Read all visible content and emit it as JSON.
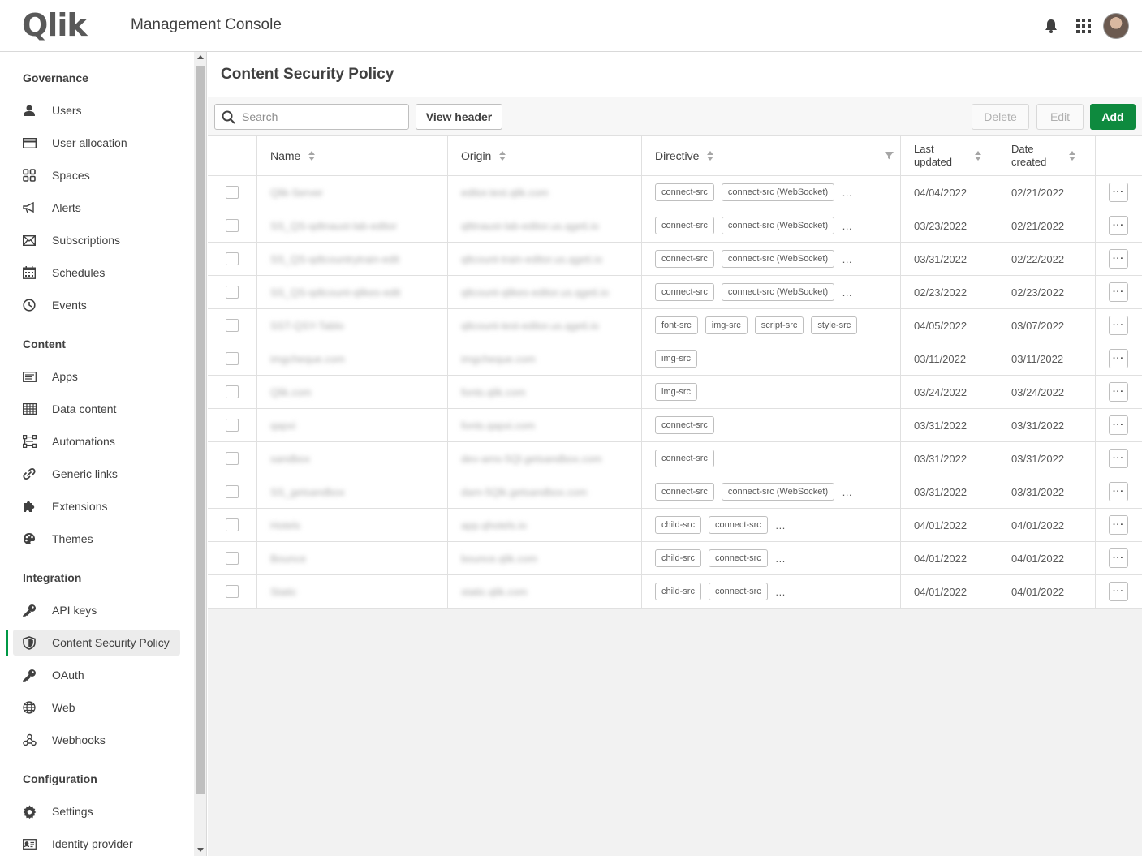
{
  "header": {
    "logo_text": "Qlik",
    "app_title": "Management Console"
  },
  "sidebar": {
    "sections": [
      {
        "title": "Governance",
        "items": [
          {
            "label": "Users",
            "icon": "user-icon"
          },
          {
            "label": "User allocation",
            "icon": "card-icon"
          },
          {
            "label": "Spaces",
            "icon": "spaces-icon"
          },
          {
            "label": "Alerts",
            "icon": "megaphone-icon"
          },
          {
            "label": "Subscriptions",
            "icon": "envelope-icon"
          },
          {
            "label": "Schedules",
            "icon": "calendar-icon"
          },
          {
            "label": "Events",
            "icon": "clock-icon"
          }
        ]
      },
      {
        "title": "Content",
        "items": [
          {
            "label": "Apps",
            "icon": "app-icon"
          },
          {
            "label": "Data content",
            "icon": "table-icon"
          },
          {
            "label": "Automations",
            "icon": "automation-icon"
          },
          {
            "label": "Generic links",
            "icon": "link-icon"
          },
          {
            "label": "Extensions",
            "icon": "puzzle-icon"
          },
          {
            "label": "Themes",
            "icon": "palette-icon"
          }
        ]
      },
      {
        "title": "Integration",
        "items": [
          {
            "label": "API keys",
            "icon": "key-icon"
          },
          {
            "label": "Content Security Policy",
            "icon": "shield-icon",
            "active": true
          },
          {
            "label": "OAuth",
            "icon": "key-icon"
          },
          {
            "label": "Web",
            "icon": "globe-icon"
          },
          {
            "label": "Webhooks",
            "icon": "webhook-icon"
          }
        ]
      },
      {
        "title": "Configuration",
        "items": [
          {
            "label": "Settings",
            "icon": "gear-icon"
          },
          {
            "label": "Identity provider",
            "icon": "id-card-icon"
          }
        ]
      }
    ]
  },
  "page": {
    "title": "Content Security Policy",
    "search_placeholder": "Search",
    "view_header": "View header",
    "delete": "Delete",
    "edit": "Edit",
    "add": "Add",
    "accent": "#0e8a3e"
  },
  "table": {
    "columns": {
      "name": "Name",
      "origin": "Origin",
      "directive": "Directive",
      "last_updated_1": "Last",
      "last_updated_2": "updated",
      "date_created_1": "Date",
      "date_created_2": "created"
    },
    "rows": [
      {
        "name": "Qlik-Server",
        "origin": "editor.test.qlik.com",
        "directives": [
          "connect-src",
          "connect-src (WebSocket)"
        ],
        "more": true,
        "updated": "04/04/2022",
        "created": "02/21/2022"
      },
      {
        "name": "SS_QS-qdtnaust-lab-editor",
        "origin": "qlttnaust-lab-editor.us.qgeti.io",
        "directives": [
          "connect-src",
          "connect-src (WebSocket)"
        ],
        "more": true,
        "updated": "03/23/2022",
        "created": "02/21/2022"
      },
      {
        "name": "SS_QS-qdtcountrytrain-edit",
        "origin": "qltcount-train-editor.us.qgeti.io",
        "directives": [
          "connect-src",
          "connect-src (WebSocket)"
        ],
        "more": true,
        "updated": "03/31/2022",
        "created": "02/22/2022"
      },
      {
        "name": "SS_QS-qdtcount-qlikes-edit",
        "origin": "qltcount-qlikes-editor.us.qgeti.io",
        "directives": [
          "connect-src",
          "connect-src (WebSocket)"
        ],
        "more": true,
        "updated": "02/23/2022",
        "created": "02/23/2022"
      },
      {
        "name": "SST-QSY-Tablo",
        "origin": "qltcount-test-editor.us.qgeti.io",
        "directives": [
          "font-src",
          "img-src",
          "script-src",
          "style-src"
        ],
        "more": false,
        "updated": "04/05/2022",
        "created": "03/07/2022"
      },
      {
        "name": "imgcheque.com",
        "origin": "imgcheque.com",
        "directives": [
          "img-src"
        ],
        "more": false,
        "updated": "03/11/2022",
        "created": "03/11/2022"
      },
      {
        "name": "Qlik.com",
        "origin": "fonts.qlik.com",
        "directives": [
          "img-src"
        ],
        "more": false,
        "updated": "03/24/2022",
        "created": "03/24/2022"
      },
      {
        "name": "qapxi",
        "origin": "fonts.qapxi.com",
        "directives": [
          "connect-src"
        ],
        "more": false,
        "updated": "03/31/2022",
        "created": "03/31/2022"
      },
      {
        "name": "sandbox",
        "origin": "dev-ams-5Ql.getsandbox.com",
        "directives": [
          "connect-src"
        ],
        "more": false,
        "updated": "03/31/2022",
        "created": "03/31/2022"
      },
      {
        "name": "SS_getsandbox",
        "origin": "dam-5Qlk.getsandbox.com",
        "directives": [
          "connect-src",
          "connect-src (WebSocket)"
        ],
        "more": true,
        "updated": "03/31/2022",
        "created": "03/31/2022"
      },
      {
        "name": "Hotels",
        "origin": "app.qhotels.io",
        "directives": [
          "child-src",
          "connect-src"
        ],
        "more": true,
        "updated": "04/01/2022",
        "created": "04/01/2022"
      },
      {
        "name": "Bounce",
        "origin": "bounce.qlik.com",
        "directives": [
          "child-src",
          "connect-src"
        ],
        "more": true,
        "updated": "04/01/2022",
        "created": "04/01/2022"
      },
      {
        "name": "Static",
        "origin": "static.qlik.com",
        "directives": [
          "child-src",
          "connect-src"
        ],
        "more": true,
        "updated": "04/01/2022",
        "created": "04/01/2022"
      }
    ]
  }
}
